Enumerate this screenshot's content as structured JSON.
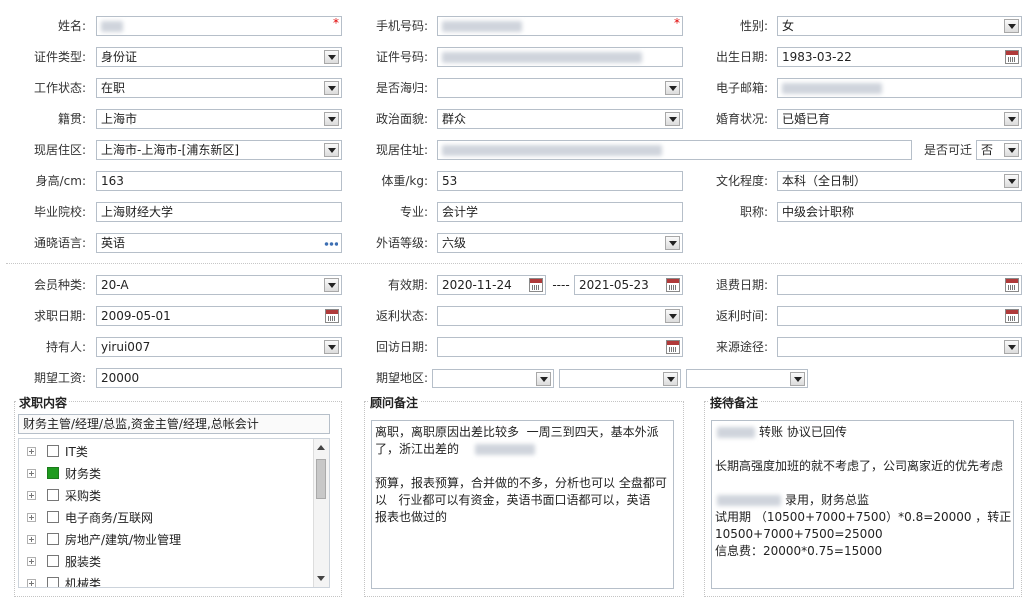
{
  "profile": {
    "name_label": "姓名:",
    "phone_label": "手机号码:",
    "gender_label": "性别:",
    "gender_value": "女",
    "id_type_label": "证件类型:",
    "id_type_value": "身份证",
    "id_no_label": "证件号码:",
    "birth_label": "出生日期:",
    "birth_value": "1983-03-22",
    "work_status_label": "工作状态:",
    "work_status_value": "在职",
    "returnee_label": "是否海归:",
    "email_label": "电子邮箱:",
    "native_label": "籍贯:",
    "native_value": "上海市",
    "political_label": "政治面貌:",
    "political_value": "群众",
    "marital_label": "婚育状况:",
    "marital_value": "已婚已育",
    "residence_area_label": "现居住区:",
    "residence_area_value": "上海市-上海市-[浦东新区]",
    "residence_addr_label": "现居住址:",
    "relocate_label": "是否可迁",
    "relocate_value": "否",
    "height_label": "身高/cm:",
    "height_value": "163",
    "weight_label": "体重/kg:",
    "weight_value": "53",
    "education_label": "文化程度:",
    "education_value": "本科（全日制）",
    "school_label": "毕业院校:",
    "school_value": "上海财经大学",
    "major_label": "专业:",
    "major_value": "会计学",
    "title_label": "职称:",
    "title_value": "中级会计职称",
    "language_label": "通晓语言:",
    "language_value": "英语",
    "foreign_level_label": "外语等级:",
    "foreign_level_value": "六级"
  },
  "membership": {
    "member_type_label": "会员种类:",
    "member_type_value": "20-A",
    "valid_label": "有效期:",
    "valid_from": "2020-11-24",
    "valid_sep": "----",
    "valid_to": "2021-05-23",
    "refund_date_label": "退费日期:",
    "job_date_label": "求职日期:",
    "job_date_value": "2009-05-01",
    "rebate_status_label": "返利状态:",
    "rebate_time_label": "返利时间:",
    "holder_label": "持有人:",
    "holder_value": "yirui007",
    "revisit_label": "回访日期:",
    "source_label": "来源途径:",
    "salary_label": "期望工资:",
    "salary_value": "20000",
    "region_label": "期望地区:"
  },
  "job_content": {
    "title": "求职内容",
    "summary": "财务主管/经理/总监,资金主管/经理,总帐会计",
    "tree": [
      {
        "label": "IT类",
        "checked": false
      },
      {
        "label": "财务类",
        "checked": true
      },
      {
        "label": "采购类",
        "checked": false
      },
      {
        "label": "电子商务/互联网",
        "checked": false
      },
      {
        "label": "房地产/建筑/物业管理",
        "checked": false
      },
      {
        "label": "服装类",
        "checked": false
      },
      {
        "label": "机械类",
        "checked": false
      }
    ]
  },
  "consultant_notes": {
    "title": "顾问备注",
    "lines": [
      "离职，离职原因出差比较多  一周三到四天，基本外派",
      "了，浙江出差的",
      "",
      "预算，报表预算，合并做的不多，分析也可以 全盘都可",
      "以   行业都可以有资金，英语书面口语都可以，英语",
      "报表也做过的"
    ]
  },
  "reception_notes": {
    "title": "接待备注",
    "lines": [
      "转账 协议已回传",
      "",
      "长期高强度加班的就不考虑了，公司离家近的优先考虑",
      "",
      "录用，财务总监",
      "试用期 （10500+7000+7500）*0.8=20000 ，转正：",
      "10500+7000+7500=25000",
      "信息费：20000*0.75=15000"
    ]
  }
}
